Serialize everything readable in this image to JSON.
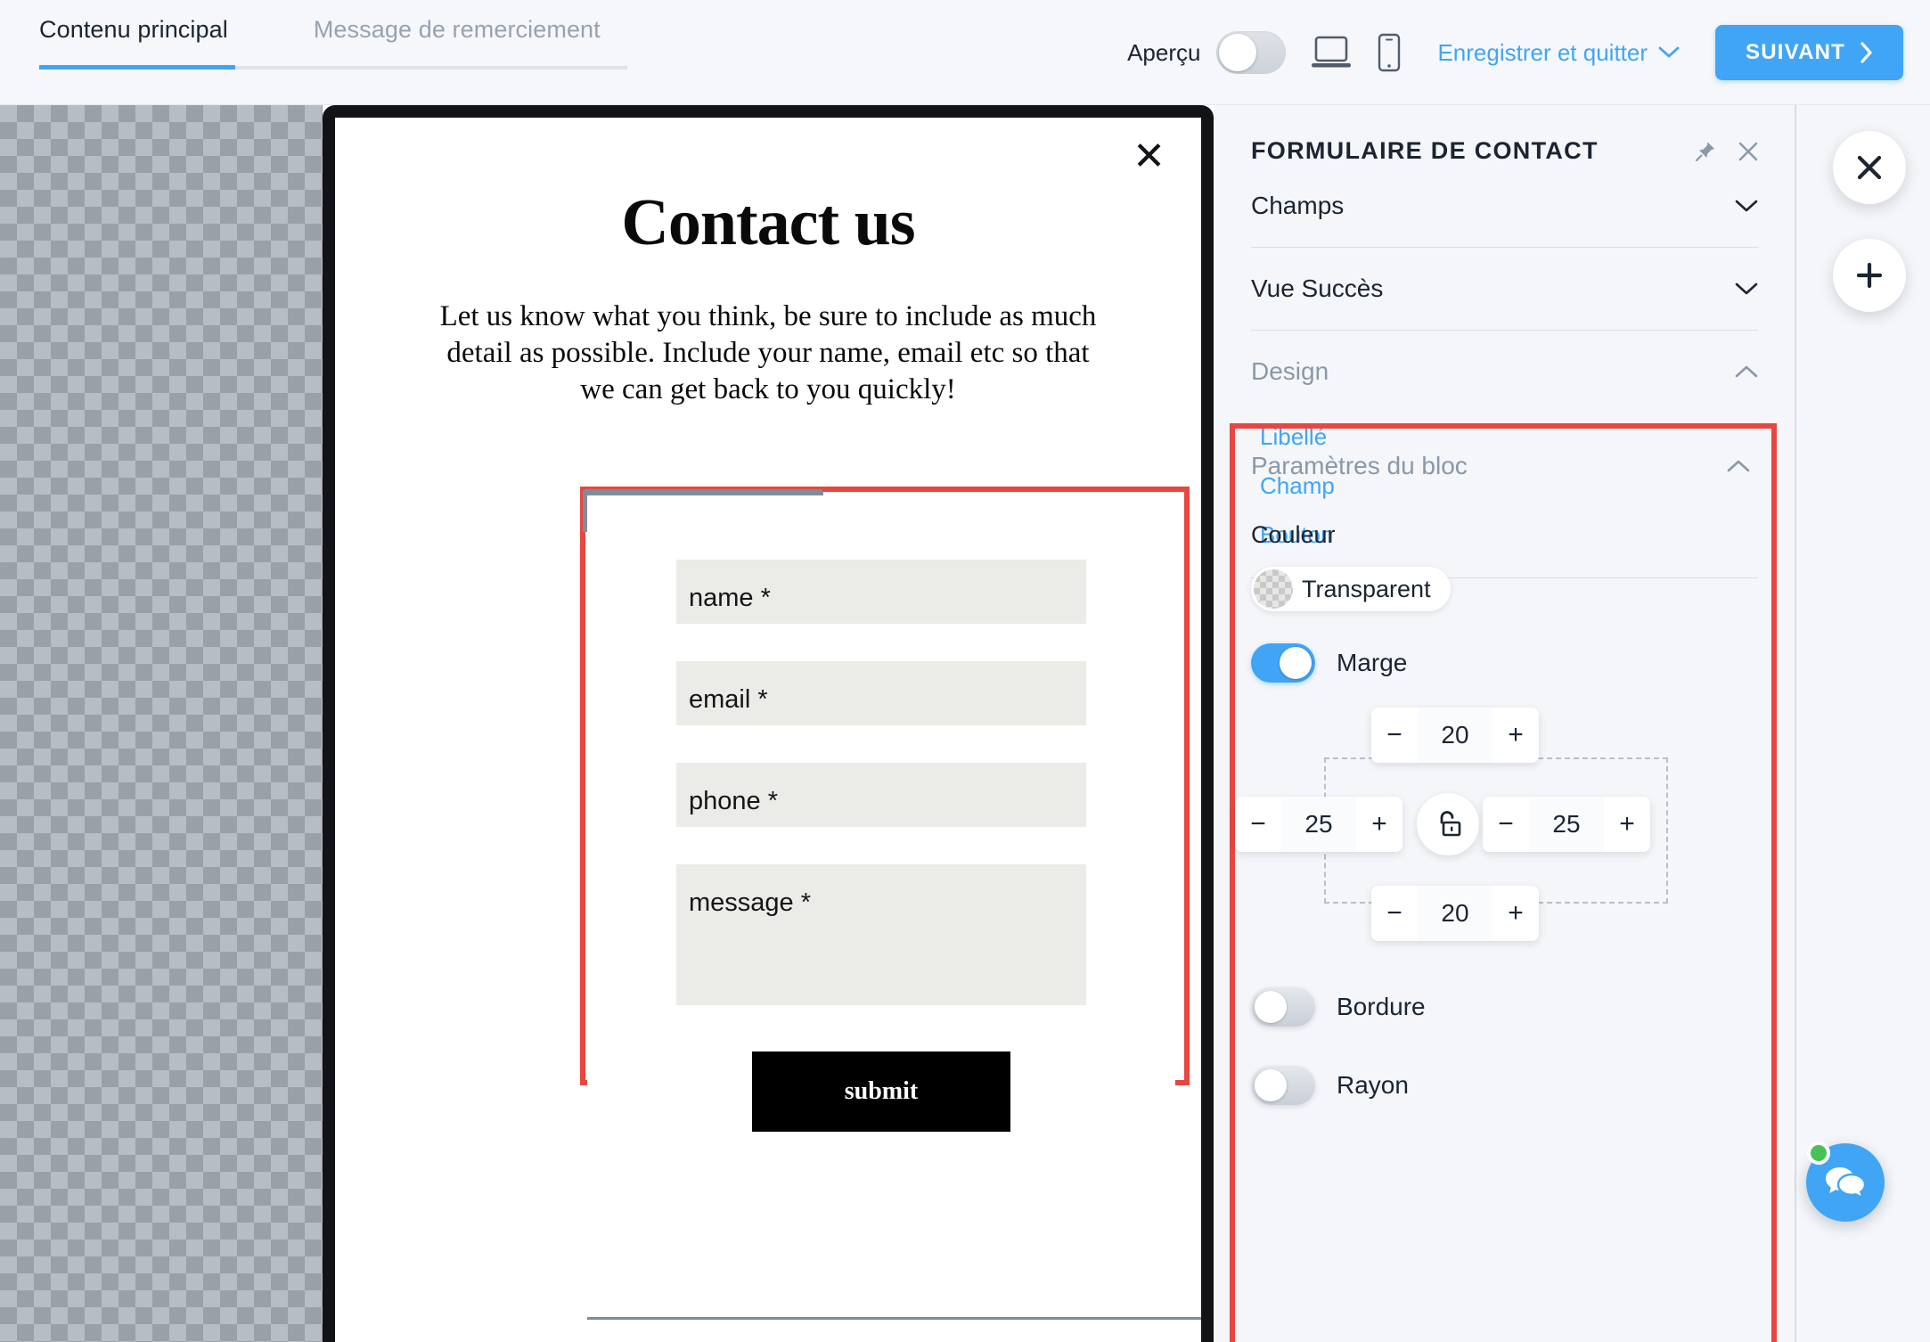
{
  "topbar": {
    "tabs": [
      {
        "label": "Contenu principal",
        "active": true
      },
      {
        "label": "Message de remerciement",
        "active": false
      }
    ],
    "preview_label": "Aperçu",
    "preview_on": false,
    "desktop_icon": "desktop-icon",
    "mobile_icon": "mobile-icon",
    "save_quit_label": "Enregistrer et quitter",
    "save_quit_caret": "chevron-down-icon",
    "next_label": "SUIVANT",
    "next_caret": "chevron-right-icon",
    "accent_color": "#41a5f5"
  },
  "canvas": {
    "transparent_area_label": "transparent-checkerboard",
    "modal_close_icon": "close-icon",
    "title": "Contact us",
    "description": "Let us know what you think, be sure to include as much detail as possible. Include your name, email etc so that we can get back to you quickly!",
    "selected_block": {
      "tag_label": "Formulaire de contact",
      "selection_color": "#e8473f"
    },
    "form": {
      "fields": [
        {
          "label": "name *",
          "type": "text"
        },
        {
          "label": "email *",
          "type": "email"
        },
        {
          "label": "phone *",
          "type": "tel"
        },
        {
          "label": "message *",
          "type": "textarea"
        }
      ],
      "submit_label": "submit",
      "field_bg": "#ebebe7",
      "submit_bg": "#000000"
    }
  },
  "panel": {
    "title": "FORMULAIRE DE CONTACT",
    "pin_icon": "pin-icon",
    "close_icon": "close-icon",
    "sections": [
      {
        "label": "Champs",
        "expanded": false,
        "chevron": "chevron-down-icon"
      },
      {
        "label": "Vue Succès",
        "expanded": false,
        "chevron": "chevron-down-icon"
      },
      {
        "label": "Design",
        "expanded": true,
        "chevron": "chevron-up-icon"
      }
    ],
    "design_links": [
      {
        "label": "Libellé"
      },
      {
        "label": "Champ"
      },
      {
        "label": "Bouton"
      }
    ],
    "block_params": {
      "label": "Paramètres du bloc",
      "chevron": "chevron-up-icon",
      "highlighted": true,
      "highlight_color": "#e8473f",
      "color_label": "Couleur",
      "color_value": "Transparent",
      "color_swatch": "transparent-swatch",
      "margin": {
        "label": "Marge",
        "enabled": true,
        "top": "20",
        "right": "25",
        "bottom": "20",
        "left": "25",
        "minus_label": "−",
        "plus_label": "+",
        "lock_icon": "unlock-icon",
        "lock_state": "unlocked"
      },
      "border": {
        "label": "Bordure",
        "enabled": false
      },
      "radius": {
        "label": "Rayon",
        "enabled": false
      }
    }
  },
  "rail": {
    "close_button_icon": "close-icon",
    "add_button_icon": "plus-icon",
    "chat_button_icon": "chat-bubbles-icon",
    "chat_status": "online",
    "chat_status_color": "#49c159",
    "chat_color": "#41a5f5"
  }
}
